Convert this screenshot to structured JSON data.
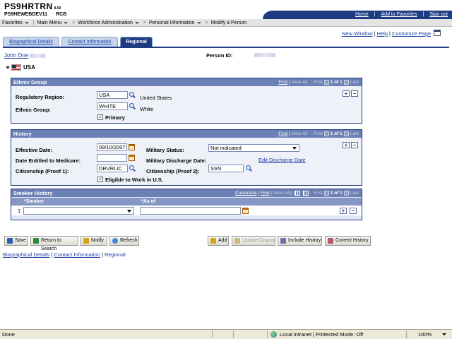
{
  "header": {
    "app_name": "PS9HRTRN",
    "version": "8.50",
    "server": "PS9HEWEBDEV11",
    "user": "RCB",
    "links": [
      "Home",
      "Add to Favorites",
      "Sign out"
    ]
  },
  "breadcrumb": {
    "items": [
      "Favorites",
      "Main Menu",
      "Workforce Administration",
      "Personal Information",
      "Modify a Person"
    ]
  },
  "tabs": [
    {
      "label": "Biographical Details",
      "active": false
    },
    {
      "label": "Contact Information",
      "active": false
    },
    {
      "label": "Regional",
      "active": true
    }
  ],
  "page_links": [
    "New Window",
    "Help",
    "Customize Page"
  ],
  "person": {
    "name": "John Doe",
    "id_label": "Person ID:",
    "country": "USA"
  },
  "ethnic_group": {
    "title": "Ethnic Group",
    "nav": {
      "find": "Find",
      "view_all": "View All",
      "first": "First",
      "range": "1 of 1",
      "last": "Last"
    },
    "regulatory_region_label": "Regulatory Region:",
    "regulatory_region_value": "USA",
    "regulatory_region_desc": "United States",
    "ethnic_group_label": "Ethnic Group:",
    "ethnic_group_value": "WHITE",
    "ethnic_group_desc": "White",
    "primary_label": "Primary",
    "primary_checked": true
  },
  "history": {
    "title": "History",
    "nav": {
      "find": "Find",
      "view_all": "View All",
      "first": "First",
      "range": "1 of 1",
      "last": "Last"
    },
    "effective_date_label": "Effective Date:",
    "effective_date_value": "09/10/2007",
    "medicare_label": "Date Entitled to Medicare:",
    "medicare_value": "",
    "citizenship1_label": "Citizenship (Proof 1):",
    "citizenship1_value": "DRVRLIC",
    "military_status_label": "Military Status:",
    "military_status_value": "Not indicated",
    "military_discharge_label": "Military Discharge Date:",
    "edit_discharge_link": "Edit Discharge Date",
    "citizenship2_label": "Citizenship (Proof 2):",
    "citizenship2_value": "SSN",
    "eligible_label": "Eligible to Work in U.S.",
    "eligible_checked": true
  },
  "smoker_history": {
    "title": "Smoker History",
    "nav": {
      "customize": "Customize",
      "find": "Find",
      "view_all": "View All",
      "first": "First",
      "range": "1 of 1",
      "last": "Last"
    },
    "col_smoker": "*Smoker",
    "col_as_of": "*As of",
    "row_number": "1",
    "smoker_value": "",
    "as_of_value": ""
  },
  "toolbar": {
    "save": "Save",
    "return": "Return to Search",
    "notify": "Notify",
    "refresh": "Refresh",
    "add": "Add",
    "update_display": "Update/Display",
    "include_history": "Include History",
    "correct_history": "Correct History"
  },
  "bottom_links": {
    "bio": "Biographical Details",
    "contact": "Contact Information",
    "regional": "Regional"
  },
  "statusbar": {
    "done": "Done",
    "zone": "Local intranet | Protected Mode: Off",
    "zoom": "100%"
  },
  "colors": {
    "header_navy": "#1e3c82",
    "group_header": "#6b80b4",
    "link_blue": "#1a3fa6"
  }
}
